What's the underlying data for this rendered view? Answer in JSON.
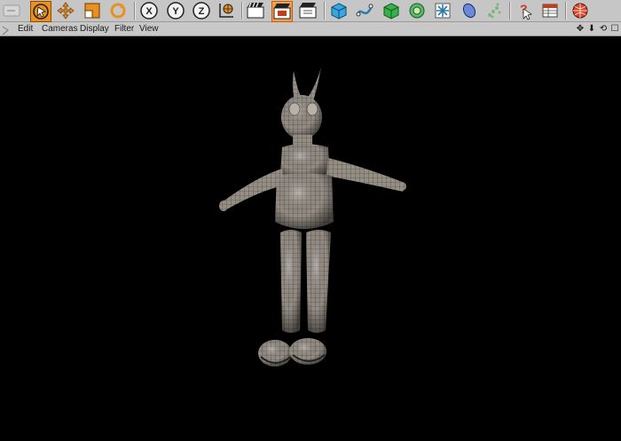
{
  "menu": {
    "items": [
      "Edit",
      "Cameras",
      "Display",
      "Filter",
      "View"
    ]
  },
  "toolbar": {
    "groups": {
      "move_tools": [
        "undo-icon",
        "live-select-icon",
        "move-icon",
        "scale-icon",
        "rotate-icon"
      ],
      "axes": [
        {
          "label": "X",
          "icon": "x-axis-icon"
        },
        {
          "label": "Y",
          "icon": "y-axis-icon"
        },
        {
          "label": "Z",
          "icon": "z-axis-icon"
        }
      ],
      "render": [
        "coordinate-system-icon",
        "render-view-icon",
        "render-picture-viewer-icon",
        "render-settings-icon"
      ],
      "objects": [
        "cube-icon",
        "spline-icon",
        "nurbs-icon",
        "deformer-icon",
        "scene-icon",
        "camera-icon",
        "light-icon"
      ],
      "misc": [
        "help-icon",
        "table-icon",
        "sphere-render-icon"
      ]
    }
  },
  "view_controls": {
    "move": "✥",
    "down": "⬇",
    "rotate": "⟲",
    "maximize": "☐"
  },
  "colors": {
    "accent_orange": "#e89020",
    "viewport_bg": "#000000",
    "toolbar_bg": "#c6c6c6",
    "mesh_fill": "#8c857c"
  }
}
